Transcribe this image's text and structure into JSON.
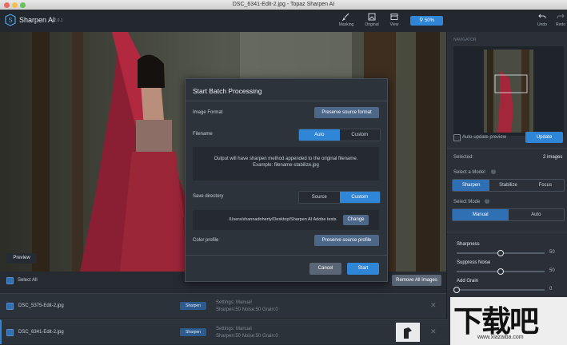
{
  "window": {
    "title": "DSC_6341-Edit-2.jpg - Topaz Sharpen AI"
  },
  "app": {
    "name": "Sharpen AI",
    "version": "v2.0.1"
  },
  "toolbar": {
    "masking": "Masking",
    "original": "Original",
    "view": "View",
    "zoom": "50%",
    "undo": "Undo",
    "redo": "Redo"
  },
  "preview_button": "Preview",
  "navigator": {
    "title": "NAVIGATOR",
    "auto_update": "Auto-update preview",
    "update_button": "Update",
    "selected_label": "Selected:",
    "selected_value": "2 images",
    "select_model": "Select a Model",
    "models": [
      "Sharpen",
      "Stabilize",
      "Focus"
    ],
    "active_model": "Sharpen",
    "select_mode": "Select Mode",
    "modes": [
      "Manual",
      "Auto"
    ],
    "active_mode": "Manual",
    "sliders": [
      {
        "label": "Sharpness",
        "value": "50",
        "fraction": 0.5
      },
      {
        "label": "Suppress Noise",
        "value": "50",
        "fraction": 0.5
      },
      {
        "label": "Add Grain",
        "value": "0",
        "fraction": 0.0
      }
    ]
  },
  "list": {
    "select_all": "Select All",
    "remove_all": "Remove All Images",
    "rows": [
      {
        "name": "DSC_5375-Edit-2.jpg",
        "tag": "Sharpen",
        "settings": "Settings: Manual",
        "detail": "Sharpen:50  Noise:50  Grain:0"
      },
      {
        "name": "DSC_6341-Edit-2.jpg",
        "tag": "Sharpen",
        "settings": "Settings: Manual",
        "detail": "Sharpen:50  Noise:50  Grain:0"
      }
    ]
  },
  "dialog": {
    "title": "Start Batch Processing",
    "image_format_label": "Image Format",
    "image_format_button": "Preserve source format",
    "filename_label": "Filename",
    "filename_options": [
      "Auto",
      "Custom"
    ],
    "filename_active": "Auto",
    "note_line1": "Output will have sharpen method appended to the original filename.",
    "note_line2": "Example: filename-stabilize.jpg",
    "save_dir_label": "Save directory",
    "save_dir_options": [
      "Source",
      "Custom"
    ],
    "save_dir_active": "Custom",
    "path": "/Users/shannadoherty/Desktop/Sharpen AI Adobe tests",
    "change_button": "Change",
    "color_profile_label": "Color profile",
    "color_profile_button": "Preserve source profile",
    "cancel": "Cancel",
    "start": "Start"
  },
  "watermark": {
    "text": "下载吧",
    "url": "www.xiazaiba.com"
  },
  "colors": {
    "accent": "#2f86d6",
    "panel": "#2b3038",
    "dialog": "#2d333b"
  }
}
